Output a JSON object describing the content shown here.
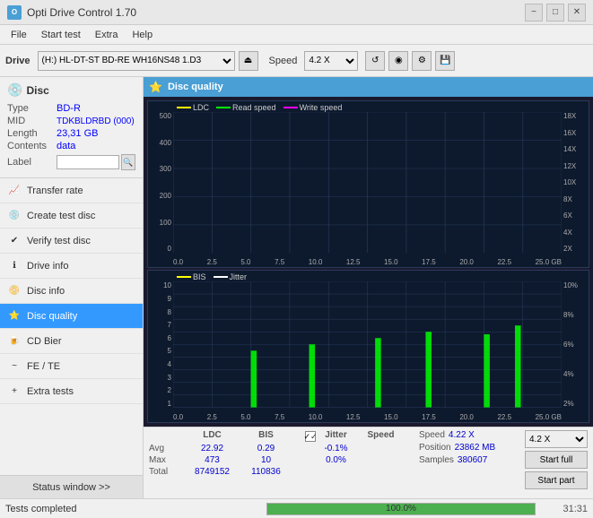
{
  "titlebar": {
    "title": "Opti Drive Control 1.70",
    "icon": "O",
    "min_label": "−",
    "max_label": "□",
    "close_label": "✕"
  },
  "menubar": {
    "items": [
      "File",
      "Start test",
      "Extra",
      "Help"
    ]
  },
  "toolbar": {
    "drive_label": "Drive",
    "drive_value": "(H:)  HL-DT-ST BD-RE  WH16NS48 1.D3",
    "eject_icon": "⏏",
    "speed_label": "Speed",
    "speed_value": "4.2 X",
    "icon1": "↺",
    "icon2": "◉",
    "icon3": "⚙",
    "icon4": "💾"
  },
  "disc": {
    "title": "Disc",
    "type_label": "Type",
    "type_val": "BD-R",
    "mid_label": "MID",
    "mid_val": "TDKBLDRBD (000)",
    "length_label": "Length",
    "length_val": "23,31 GB",
    "contents_label": "Contents",
    "contents_val": "data",
    "label_label": "Label",
    "label_val": "",
    "label_placeholder": ""
  },
  "sidebar": {
    "items": [
      {
        "id": "transfer-rate",
        "label": "Transfer rate",
        "icon": "📈"
      },
      {
        "id": "create-test-disc",
        "label": "Create test disc",
        "icon": "💿"
      },
      {
        "id": "verify-test-disc",
        "label": "Verify test disc",
        "icon": "✔"
      },
      {
        "id": "drive-info",
        "label": "Drive info",
        "icon": "ℹ"
      },
      {
        "id": "disc-info",
        "label": "Disc info",
        "icon": "📀"
      },
      {
        "id": "disc-quality",
        "label": "Disc quality",
        "icon": "⭐",
        "active": true
      },
      {
        "id": "cd-bier",
        "label": "CD Bier",
        "icon": "🍺"
      },
      {
        "id": "fe-te",
        "label": "FE / TE",
        "icon": "~"
      },
      {
        "id": "extra-tests",
        "label": "Extra tests",
        "icon": "+"
      }
    ],
    "status_window": "Status window >>"
  },
  "chart": {
    "title": "Disc quality",
    "legend1": {
      "items": [
        {
          "label": "LDC",
          "color": "#ffff00"
        },
        {
          "label": "Read speed",
          "color": "#00ff00"
        },
        {
          "label": "Write speed",
          "color": "#ff00ff"
        }
      ]
    },
    "legend2": {
      "items": [
        {
          "label": "BIS",
          "color": "#ffff00"
        },
        {
          "label": "Jitter",
          "color": "#ffffff"
        }
      ]
    },
    "chart1_y_max": 500,
    "chart1_y_labels_left": [
      "500",
      "400",
      "300",
      "200",
      "100",
      "0"
    ],
    "chart1_y_labels_right": [
      "18X",
      "16X",
      "14X",
      "12X",
      "10X",
      "8X",
      "6X",
      "4X",
      "2X"
    ],
    "chart2_y_max": 10,
    "chart2_y_labels_left": [
      "10",
      "9",
      "8",
      "7",
      "6",
      "5",
      "4",
      "3",
      "2",
      "1"
    ],
    "chart2_y_labels_right": [
      "10%",
      "8%",
      "6%",
      "4%",
      "2%"
    ],
    "x_labels": [
      "0.0",
      "2.5",
      "5.0",
      "7.5",
      "10.0",
      "12.5",
      "15.0",
      "17.5",
      "20.0",
      "22.5",
      "25.0 GB"
    ]
  },
  "stats": {
    "headers": [
      "",
      "LDC",
      "BIS",
      "",
      "Jitter",
      "Speed",
      ""
    ],
    "avg_label": "Avg",
    "avg_ldc": "22.92",
    "avg_bis": "0.29",
    "avg_jitter": "-0.1%",
    "max_label": "Max",
    "max_ldc": "473",
    "max_bis": "10",
    "max_jitter": "0.0%",
    "total_label": "Total",
    "total_ldc": "8749152",
    "total_bis": "110836",
    "speed_label": "Speed",
    "speed_val": "4.22 X",
    "position_label": "Position",
    "position_val": "23862 MB",
    "samples_label": "Samples",
    "samples_val": "380607",
    "speed_select": "4.2 X",
    "jitter_checked": true,
    "jitter_label": "Jitter",
    "start_full_label": "Start full",
    "start_part_label": "Start part"
  },
  "statusbar": {
    "text": "Tests completed",
    "progress": 100,
    "progress_text": "100.0%",
    "time": "31:31"
  }
}
